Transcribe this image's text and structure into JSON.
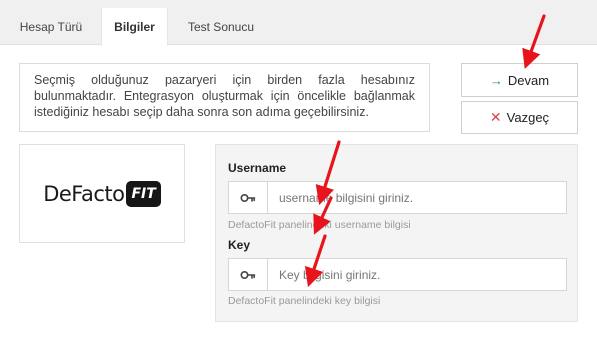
{
  "tabs": [
    {
      "label": "Hesap Türü"
    },
    {
      "label": "Bilgiler",
      "active": true
    },
    {
      "label": "Test Sonucu"
    }
  ],
  "info_text": "Seçmiş olduğunuz pazaryeri için birden fazla hesabınız bulunmaktadır. Entegrasyon oluşturmak için öncelikle bağlanmak istediğiniz hesabı seçip daha sonra son adıma geçebilirsiniz.",
  "buttons": {
    "devam": {
      "label": "Devam",
      "icon": "arrow-right-icon",
      "icon_glyph": "→",
      "icon_color": "#2e9b4a"
    },
    "vazgec": {
      "label": "Vazgeç",
      "icon": "close-icon",
      "icon_glyph": "✕",
      "icon_color": "#e0424a"
    }
  },
  "logo": {
    "word": "DeFacto",
    "badge": "FIT"
  },
  "form": {
    "username": {
      "label": "Username",
      "placeholder": "username bilgisini giriniz.",
      "value": "",
      "help": "DefactoFit panelindeki username bilgisi",
      "icon": "key-icon"
    },
    "key": {
      "label": "Key",
      "placeholder": "Key bilgisini giriniz.",
      "value": "",
      "help": "DefactoFit panelindeki key bilgisi",
      "icon": "key-icon"
    }
  },
  "annotations": {
    "color": "#e8141b",
    "count": 4
  }
}
